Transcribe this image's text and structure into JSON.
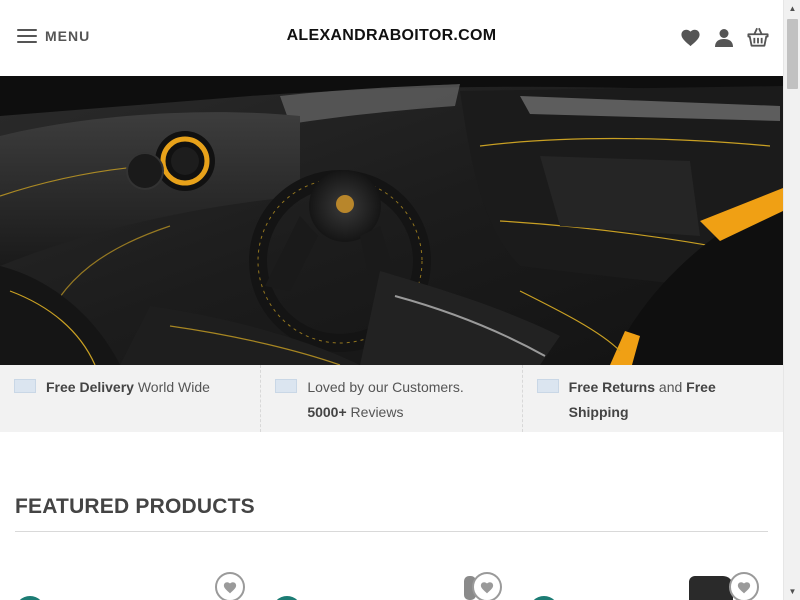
{
  "header": {
    "menu_label": "MENU",
    "site_title": "ALEXANDRABOITOR.COM",
    "icons": [
      "heart-icon",
      "user-icon",
      "basket-icon"
    ]
  },
  "hero": {
    "image": "car-interior-photo"
  },
  "features": [
    {
      "bold": "Free Delivery",
      "rest": " World Wide"
    },
    {
      "pre": "Loved by our Customers.",
      "bold": "5000+",
      "rest": " Reviews"
    },
    {
      "bold": "Free Returns",
      "mid": " and ",
      "bold2": "Free Shipping"
    }
  ],
  "featured": {
    "title": "FEATURED PRODUCTS"
  },
  "colors": {
    "badge": "#1c7c74",
    "features_bg": "#f2f2f2",
    "accent_stitch": "#e8b21a"
  }
}
